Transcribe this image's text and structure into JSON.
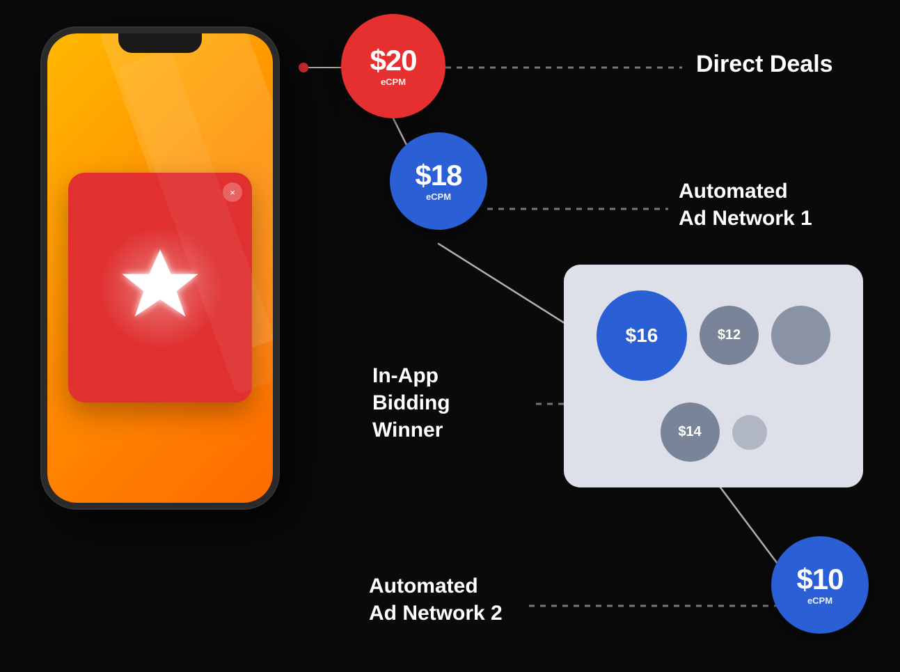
{
  "background": "#0a0a0a",
  "phone": {
    "adCard": {
      "closeButton": "×"
    }
  },
  "bubbles": {
    "b20": {
      "amount": "$20",
      "label": "eCPM"
    },
    "b18": {
      "amount": "$18",
      "label": "eCPM"
    },
    "b16": {
      "amount": "$16",
      "label": ""
    },
    "b14": {
      "amount": "$14",
      "label": ""
    },
    "b12": {
      "amount": "$12",
      "label": ""
    },
    "b10": {
      "amount": "$10",
      "label": "eCPM"
    }
  },
  "labels": {
    "directDeals": "Direct Deals",
    "automatedAdNetwork1Line1": "Automated",
    "automatedAdNetwork1Line2": "Ad Network 1",
    "inAppBiddingLine1": "In-App",
    "inAppBiddingLine2": "Bidding",
    "inAppBiddingLine3": "Winner",
    "automatedAdNetwork2Line1": "Automated",
    "automatedAdNetwork2Line2": "Ad Network 2"
  }
}
